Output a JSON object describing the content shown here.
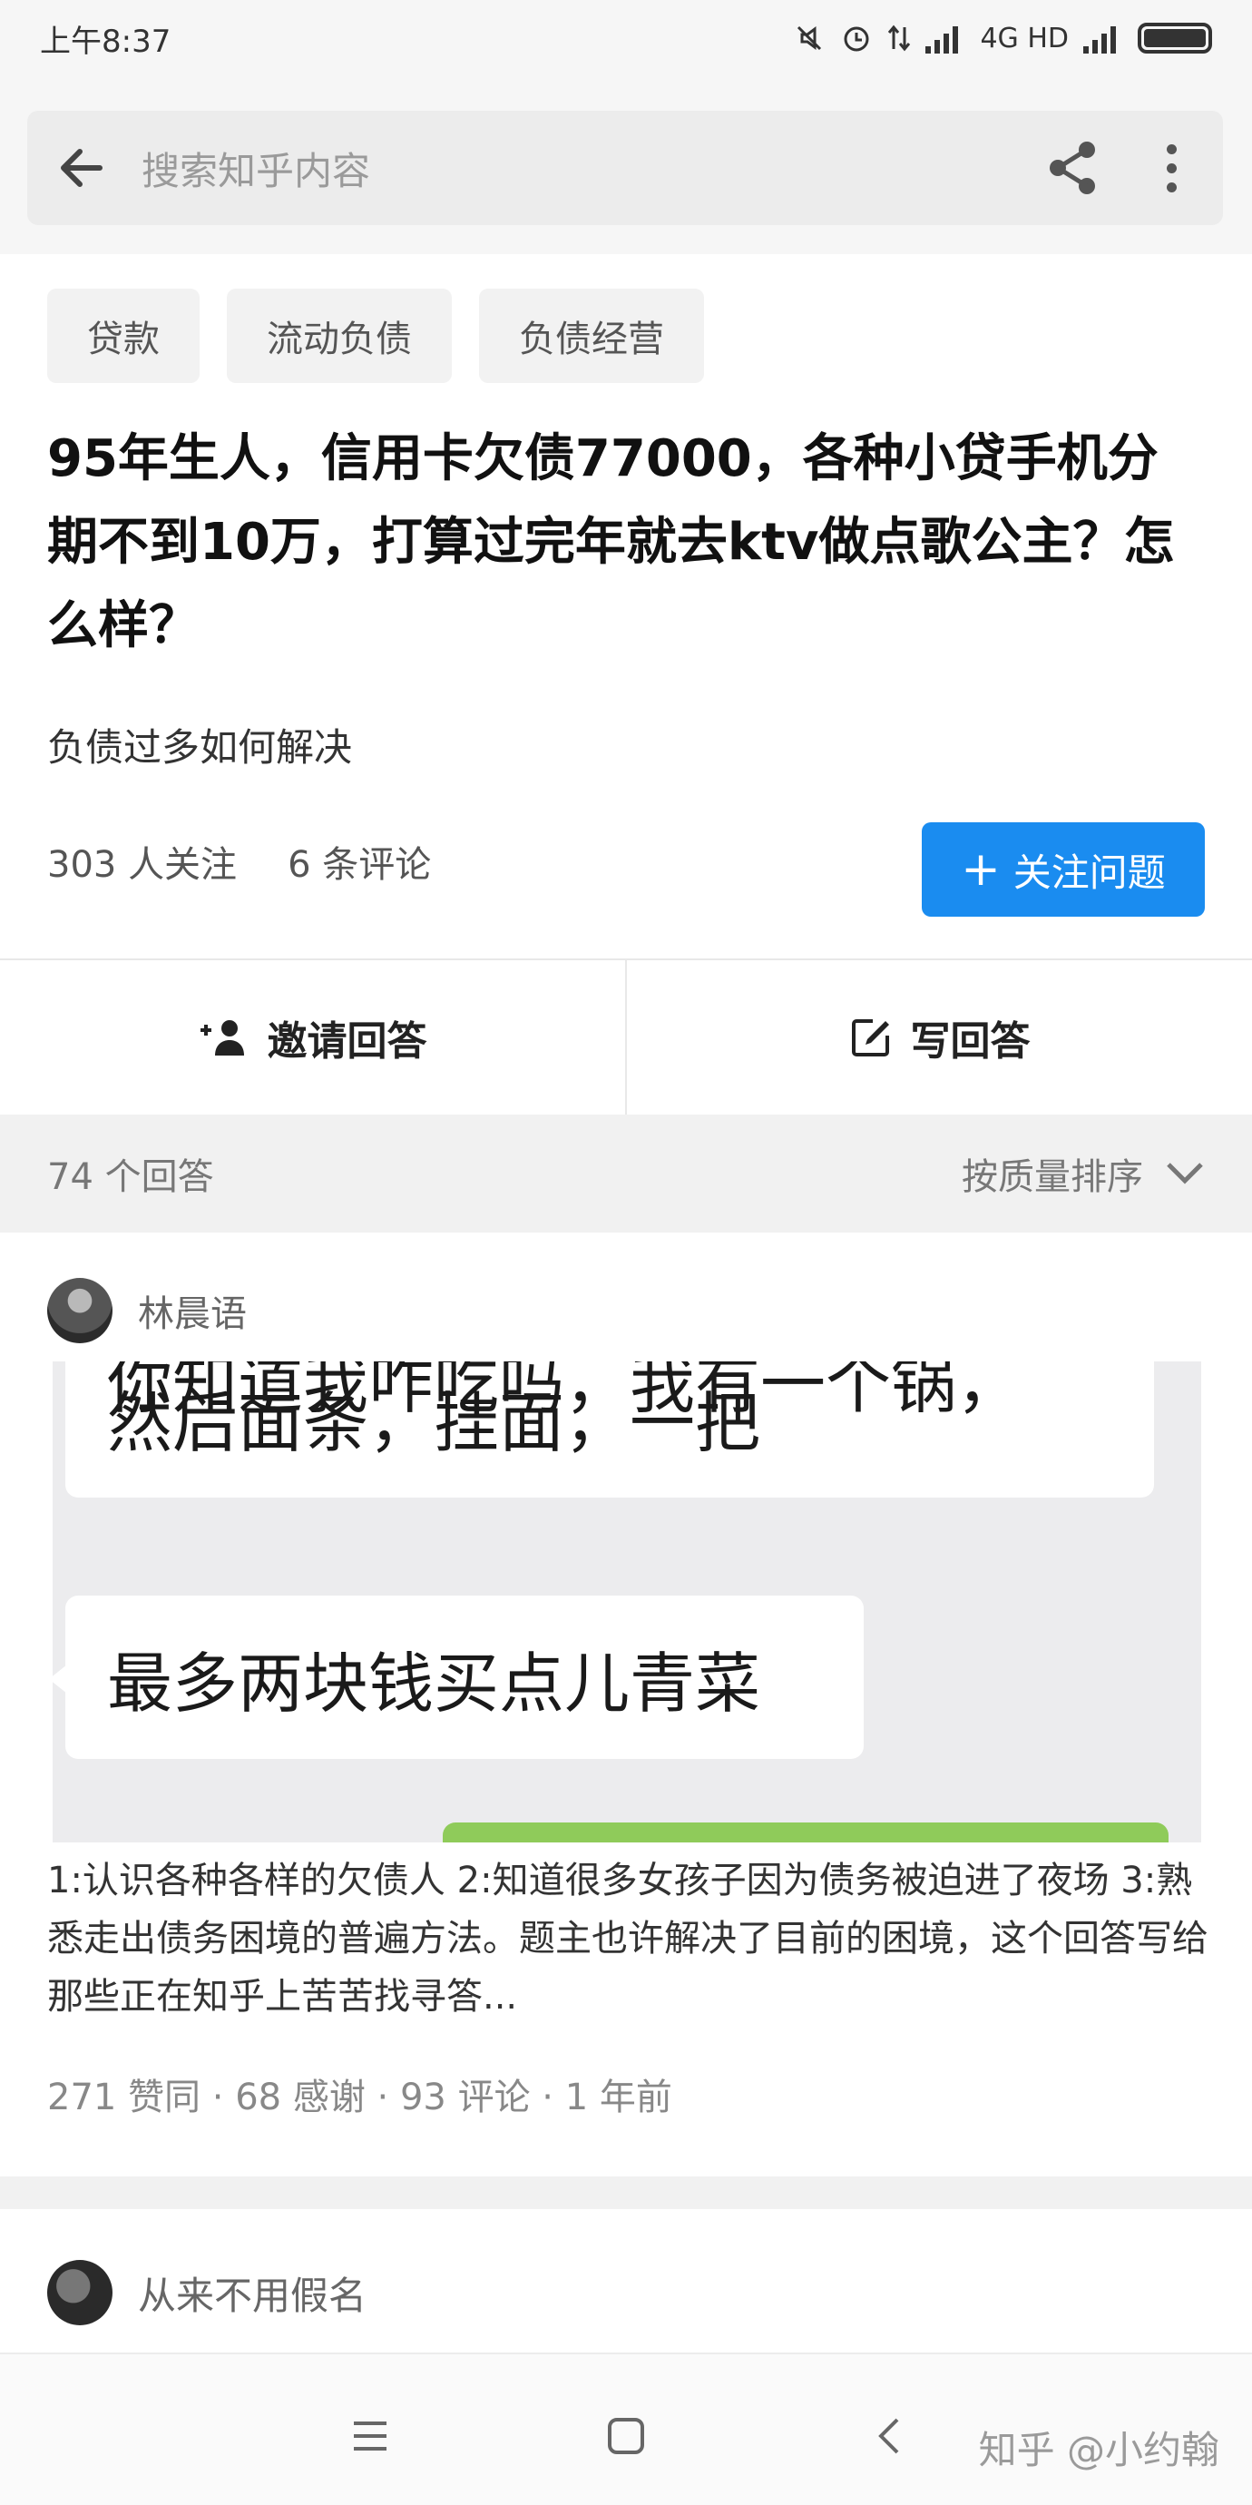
{
  "status_bar": {
    "time": "上午8:37",
    "network": "4G HD"
  },
  "search": {
    "placeholder": "搜索知乎内容"
  },
  "tags": [
    "贷款",
    "流动负债",
    "负债经营"
  ],
  "question": {
    "title": "95年生人，信用卡欠债77000，各种小贷手机分期不到10万，打算过完年就去ktv做点歌公主？怎么样？",
    "topic": "负债过多如何解决",
    "followers": "303 人关注",
    "comments": "6 条评论",
    "follow_button": "关注问题"
  },
  "actions": {
    "invite": "邀请回答",
    "write": "写回答"
  },
  "answers_bar": {
    "count": "74 个回答",
    "sort": "按质量排序"
  },
  "answer": {
    "author": "林晨语",
    "chat_image": {
      "line_partial": "你知道我咋吃吗，我有一个锅，",
      "line_1": "然后面条，挂面，一把",
      "line_2": "最多两块钱买点儿青菜"
    },
    "excerpt": "1:认识各种各样的欠债人 2:知道很多女孩子因为债务被迫进了夜场 3:熟悉走出债务困境的普遍方法。题主也许解决了目前的困境，这个回答写给那些正在知乎上苦苦找寻答...",
    "meta": "271 赞同 · 68 感谢 · 93 评论 · 1 年前"
  },
  "answer2": {
    "author": "从来不用假名"
  },
  "watermark": "知乎 @小约翰"
}
